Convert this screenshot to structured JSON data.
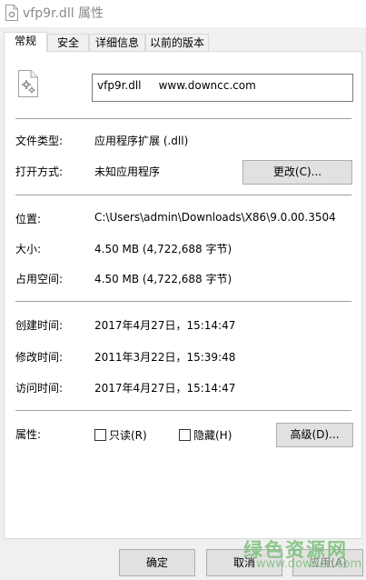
{
  "window": {
    "title": "vfp9r.dll 属性"
  },
  "tabs": [
    {
      "label": "常规",
      "active": true
    },
    {
      "label": "安全",
      "active": false
    },
    {
      "label": "详细信息",
      "active": false
    },
    {
      "label": "以前的版本",
      "active": false
    }
  ],
  "general": {
    "file_name": "vfp9r.dll     www.downcc.com",
    "file_type": {
      "label": "文件类型:",
      "value": "应用程序扩展 (.dll)"
    },
    "opens_with": {
      "label": "打开方式:",
      "value": "未知应用程序",
      "button": "更改(C)..."
    },
    "location": {
      "label": "位置:",
      "value": "C:\\Users\\admin\\Downloads\\X86\\9.0.00.3504"
    },
    "size": {
      "label": "大小:",
      "value": "4.50 MB (4,722,688 字节)"
    },
    "size_on_disk": {
      "label": "占用空间:",
      "value": "4.50 MB (4,722,688 字节)"
    },
    "created": {
      "label": "创建时间:",
      "value": "2017年4月27日，15:14:47"
    },
    "modified": {
      "label": "修改时间:",
      "value": "2011年3月22日，15:39:48"
    },
    "accessed": {
      "label": "访问时间:",
      "value": "2017年4月27日，15:14:47"
    },
    "attributes": {
      "label": "属性:",
      "readonly": {
        "label": "只读(R)",
        "checked": false
      },
      "hidden": {
        "label": "隐藏(H)",
        "checked": false
      },
      "advanced_button": "高级(D)..."
    }
  },
  "footer": {
    "ok": "确定",
    "cancel": "取消",
    "apply": "应用(A)"
  },
  "watermark": {
    "main": "绿色资源网",
    "sub": "www.downcc.com"
  },
  "icons": {
    "title": "dll-file-icon",
    "file": "dll-gear-file-icon"
  },
  "colors": {
    "watermark": "#7bc17a",
    "title_text": "#8a8a8a",
    "divider": "#a0a0a0"
  }
}
